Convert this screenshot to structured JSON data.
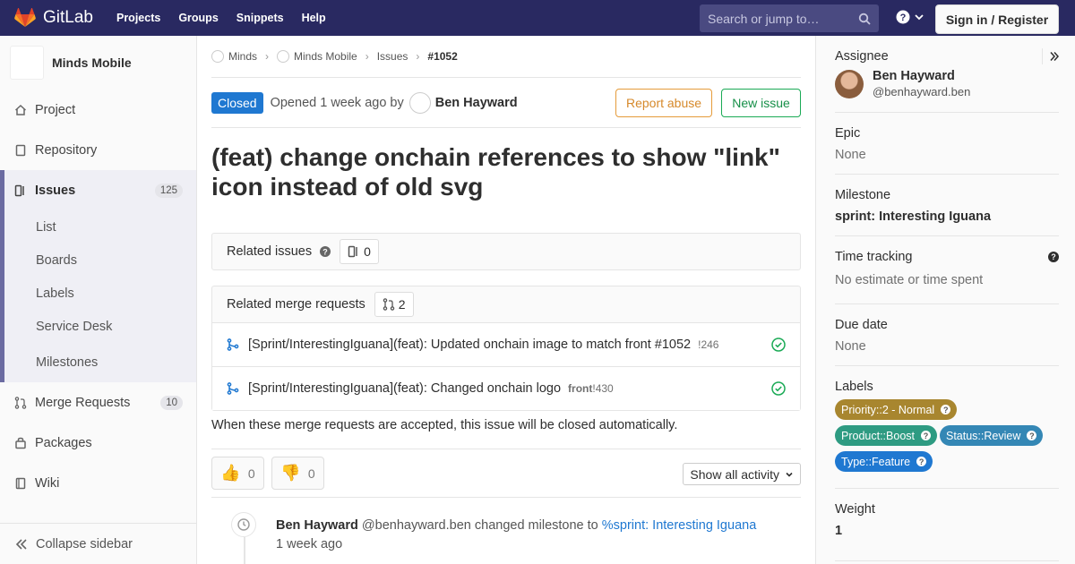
{
  "navbar": {
    "brand": "GitLab",
    "links": [
      "Projects",
      "Groups",
      "Snippets",
      "Help"
    ],
    "search_placeholder": "Search or jump to…",
    "signin_label": "Sign in / Register",
    "bg_color": "#292961"
  },
  "sidebar": {
    "project_name": "Minds Mobile",
    "items": [
      {
        "label": "Project",
        "icon": "home-icon"
      },
      {
        "label": "Repository",
        "icon": "doc-icon"
      },
      {
        "label": "Issues",
        "icon": "issues-icon",
        "count": "125"
      },
      {
        "label": "Merge Requests",
        "icon": "merge-request-icon",
        "count": "10"
      },
      {
        "label": "Packages",
        "icon": "package-icon"
      },
      {
        "label": "Wiki",
        "icon": "book-icon"
      }
    ],
    "issues_subitems": [
      "List",
      "Boards",
      "Labels",
      "Service Desk",
      "Milestones"
    ],
    "collapse_label": "Collapse sidebar"
  },
  "breadcrumb": [
    "Minds",
    "Minds Mobile",
    "Issues",
    "#1052"
  ],
  "issue": {
    "status": "Closed",
    "opened_text": "Opened 1 week ago by",
    "author": "Ben Hayward",
    "report_label": "Report abuse",
    "new_issue_label": "New issue",
    "title": "(feat) change onchain references to show \"link\" icon instead of old svg",
    "related_issues_label": "Related issues",
    "related_issues_count": "0",
    "related_mrs_label": "Related merge requests",
    "related_mrs_count": "2",
    "merge_requests": [
      {
        "title": "[Sprint/InterestingIguana](feat): Updated onchain image to match front #1052",
        "ref_prefix": "",
        "ref": "!246"
      },
      {
        "title": "[Sprint/InterestingIguana](feat): Changed onchain logo",
        "ref_prefix": "front",
        "ref": "!430"
      }
    ],
    "auto_close_note": "When these merge requests are accepted, this issue will be closed automatically.",
    "thumbs_up": "0",
    "thumbs_down": "0",
    "activity_filter": "Show all activity"
  },
  "note": {
    "author": "Ben Hayward",
    "username": "@benhayward.ben",
    "action": "changed milestone to",
    "milestone_link": "%sprint: Interesting Iguana",
    "time": "1 week ago"
  },
  "right": {
    "assignee_label": "Assignee",
    "assignee_name": "Ben Hayward",
    "assignee_user": "@benhayward.ben",
    "epic_label": "Epic",
    "epic_value": "None",
    "milestone_label": "Milestone",
    "milestone_value": "sprint: Interesting Iguana",
    "time_label": "Time tracking",
    "time_value": "No estimate or time spent",
    "due_label": "Due date",
    "due_value": "None",
    "labels_label": "Labels",
    "labels": [
      {
        "text": "Priority::2 - Normal",
        "color": "#a8862f"
      },
      {
        "text": "Product::Boost",
        "color": "#2e9b82"
      },
      {
        "text": "Status::Review",
        "color": "#3487b5"
      },
      {
        "text": "Type::Feature",
        "color": "#1f78d1"
      }
    ],
    "weight_label": "Weight",
    "weight_value": "1"
  }
}
